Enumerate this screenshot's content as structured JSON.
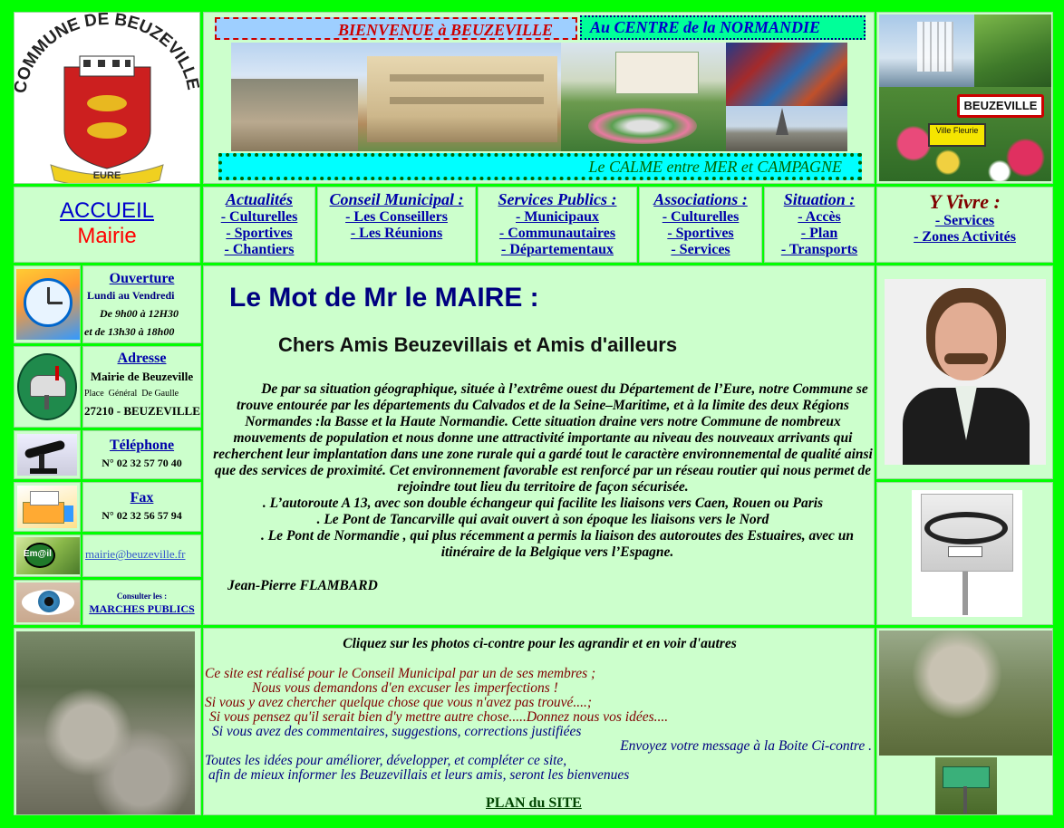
{
  "header": {
    "welcome": "BIENVENUE à BEUZEVILLE",
    "centre": "Au CENTRE de la NORMANDIE",
    "calme": "Le CALME entre MER et CAMPAGNE",
    "logo_text": "COMMUNE DE BEUZEVILLE",
    "logo_banner": "EURE",
    "town_sign": "BEUZEVILLE",
    "ville_fleurie": "Ville Fleurie"
  },
  "nav": {
    "accueil": "ACCUEIL",
    "mairie": "Mairie",
    "actualites": {
      "title": "Actualités",
      "items": [
        "- Culturelles",
        "- Sportives",
        "- Chantiers"
      ]
    },
    "conseil": {
      "title": "Conseil Municipal :",
      "items": [
        "- Les Conseillers",
        "- Les Réunions"
      ]
    },
    "services": {
      "title": "Services Publics :",
      "items": [
        "- Municipaux",
        "- Communautaires",
        "- Départementaux"
      ]
    },
    "associations": {
      "title": "Associations :",
      "items": [
        "- Culturelles",
        "- Sportives",
        "- Services"
      ]
    },
    "situation": {
      "title": "Situation :",
      "items": [
        "- Accès",
        "- Plan",
        "- Transports"
      ]
    },
    "yvivre": {
      "title": "Y Vivre :",
      "items": [
        "- Services",
        "- Zones Activités"
      ]
    }
  },
  "sidebar": {
    "ouverture_title": "Ouverture",
    "ouverture_days": "Lundi au Vendredi",
    "ouverture_am": "De 9h00 à 12H30",
    "ouverture_pm": "et de 13h30 à 18h00",
    "adresse_title": "Adresse",
    "adresse_name": "Mairie de Beuzeville",
    "adresse_street": "Place  Général  De Gaulle",
    "adresse_city": "27210 - BEUZEVILLE",
    "telephone_title": "Téléphone",
    "telephone_number": "N° 02 32 57 70 40",
    "fax_title": "Fax",
    "fax_number": "N° 02 32 56 57 94",
    "email": "mairie@beuzeville.fr",
    "email_icon_text": "Em@il",
    "marches_consult": "Consulter les :",
    "marches_link": "MARCHES PUBLICS"
  },
  "main": {
    "title": "Le Mot de Mr le MAIRE :",
    "greeting": "Chers Amis Beuzevillais et Amis d'ailleurs",
    "paragraph": "De par sa situation géographique, située à l’extrême ouest du Département de l’Eure, notre Commune se trouve entourée par les départements du Calvados et de la Seine–Maritime, et à la limite des deux Régions Normandes :la Basse et la Haute Normandie. Cette situation draine vers notre Commune de nombreux mouvements de population et nous donne une attractivité importante au niveau des nouveaux arrivants qui recherchent leur implantation dans une zone rurale qui a gardé tout le caractère environnemental de qualité ainsi que des services de proximité. Cet environnement favorable est renforcé par un réseau routier qui nous permet de rejoindre tout lieu du territoire de façon sécurisée.",
    "bullet1": ". L’autoroute A 13, avec son double échangeur qui facilite les liaisons vers Caen, Rouen ou Paris",
    "bullet2": ". Le Pont de Tancarville qui avait ouvert à son époque les liaisons vers le Nord",
    "bullet3": ". Le Pont de Normandie , qui plus récemment a permis la liaison des autoroutes des Estuaires, avec un itinéraire de la Belgique vers l’Espagne.",
    "signature": "Jean-Pierre FLAMBARD"
  },
  "footer": {
    "click_photos": "Cliquez sur les photos ci-contre pour les agrandir et en voir d'autres",
    "line1": "Ce site est réalisé pour le Conseil Municipal par un de ses membres ;",
    "line2": "Nous vous demandons d'en excuser les imperfections !",
    "line3": "Si vous y avez chercher quelque chose que vous n'avez pas trouvé....;",
    "line4": "Si vous pensez qu'il serait bien d'y mettre autre chose.....Donnez nous vos idées....",
    "line5": "Si vous avez des commentaires, suggestions, corrections justifiées",
    "line6": "Envoyez votre message à la Boite Ci-contre .",
    "line7": "Toutes les idées pour améliorer, développer, et compléter ce site,",
    "line8": "afin de mieux informer les Beuzevillais et leurs amis, seront les bienvenues",
    "plan": "PLAN du SITE"
  },
  "colors": {
    "page_bg": "#00ff00",
    "cell_bg": "#ccffcc",
    "link": "#0000aa",
    "maroon": "#800000",
    "red": "#cc0000"
  }
}
